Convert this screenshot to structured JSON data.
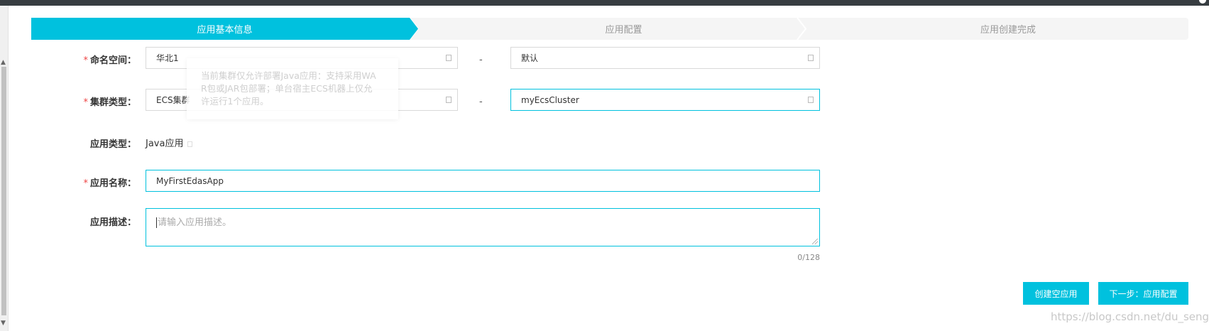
{
  "steps": [
    {
      "label": "应用基本信息"
    },
    {
      "label": "应用配置"
    },
    {
      "label": "应用创建完成"
    }
  ],
  "form": {
    "namespace": {
      "label": "命名空间：",
      "required_mark": "*",
      "region": "华北1",
      "value": "默认",
      "dash": "-"
    },
    "cluster_type": {
      "label": "集群类型：",
      "required_mark": "*",
      "type": "ECS集群",
      "cluster": "myEcsCluster",
      "dash": "-"
    },
    "app_type": {
      "label": "应用类型：",
      "value": "Java应用"
    },
    "app_name": {
      "label": "应用名称：",
      "required_mark": "*",
      "value": "MyFirstEdasApp"
    },
    "app_desc": {
      "label": "应用描述：",
      "placeholder": "请输入应用描述。",
      "counter": "0/128"
    }
  },
  "tooltip": {
    "lines": [
      "当前集群仅允许部署Java应用：支持采用WA",
      "R包或JAR包部署；单台宿主ECS机器上仅允",
      "许运行1个应用。"
    ]
  },
  "buttons": {
    "create_empty": "创建空应用",
    "next": "下一步：应用配置"
  },
  "watermark": "https://blog.csdn.net/du_senge",
  "colors": {
    "accent": "#00c1de",
    "required": "#e44444"
  }
}
